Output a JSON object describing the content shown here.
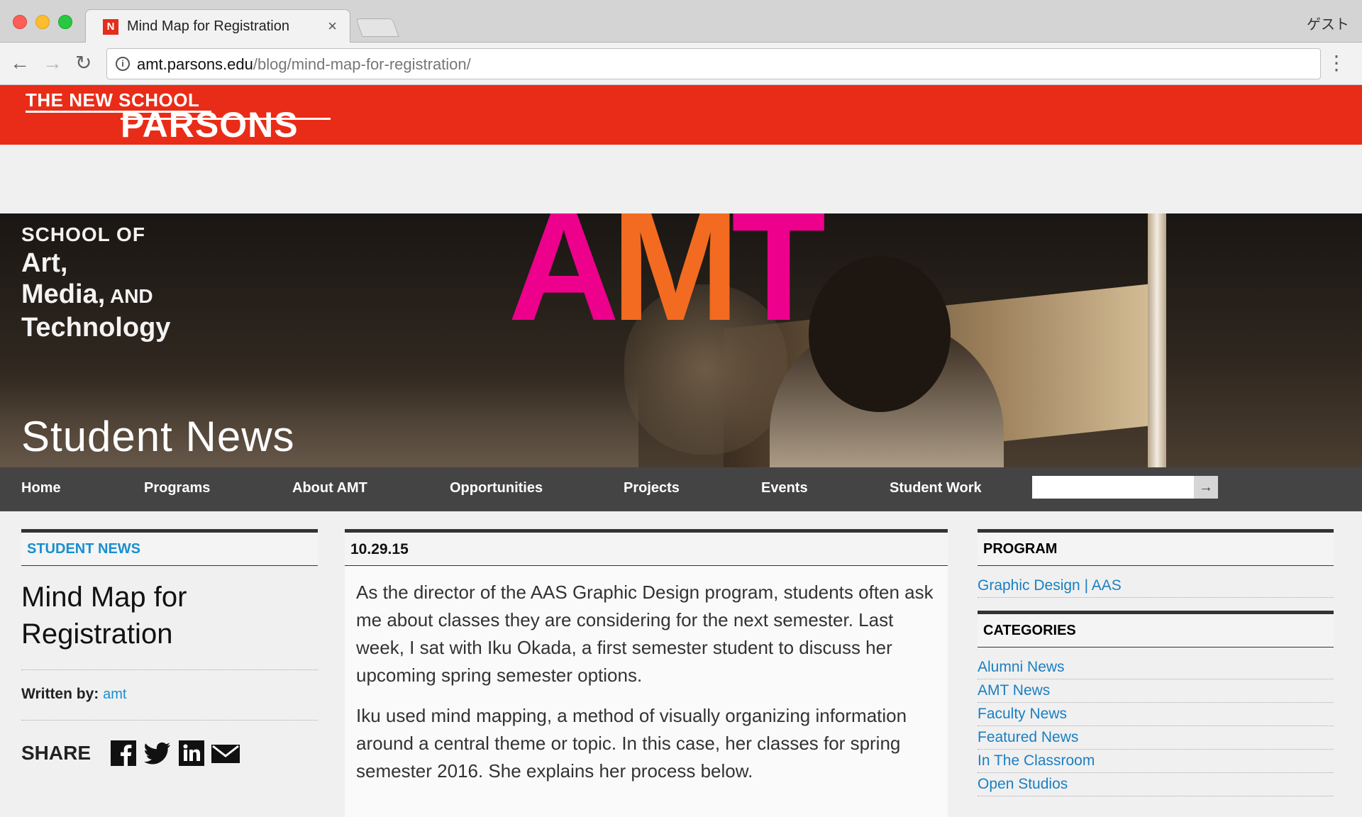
{
  "browser": {
    "tab_title": "Mind Map for Registration",
    "tab_close": "×",
    "profile": "ゲスト",
    "url_domain": "amt.parsons.edu",
    "url_path": "/blog/mind-map-for-registration/",
    "favicon_letter": "N"
  },
  "site": {
    "logo_top": "THE NEW SCHOOL",
    "logo_main": "PARSONS",
    "accent": "#e92c17",
    "link_color": "#1a8ecf"
  },
  "hero": {
    "school_of": "SCHOOL OF",
    "line1": "Art,",
    "line2": "Media,",
    "line2_small": " AND",
    "line3": "Technology",
    "amt_a": "A",
    "amt_m": "M",
    "amt_t": "T",
    "title": "Student News"
  },
  "nav": {
    "items": [
      "Home",
      "Programs",
      "About AMT",
      "Opportunities",
      "Projects",
      "Events",
      "Student Work"
    ],
    "search_go": "→"
  },
  "left": {
    "section": "STUDENT NEWS",
    "title": "Mind Map for Registration",
    "written_by_label": "Written by:",
    "author": "amt",
    "share_label": "SHARE",
    "social_icons": [
      "facebook-icon",
      "twitter-icon",
      "linkedin-icon",
      "email-icon"
    ]
  },
  "article": {
    "date": "10.29.15",
    "paragraphs": [
      "As the director of the AAS Graphic Design program, students often ask me about classes they are considering for the next semester. Last week, I sat with Iku Okada, a first semester student to discuss her upcoming spring semester options.",
      "Iku used mind mapping, a method of visually organizing information around a central theme or topic. In this case,  her classes for spring semester 2016. She explains her process below."
    ]
  },
  "right": {
    "program_head": "PROGRAM",
    "program_link": "Graphic Design | AAS",
    "categories_head": "CATEGORIES",
    "categories": [
      "Alumni News",
      "AMT News",
      "Faculty News",
      "Featured News",
      "In The Classroom",
      "Open Studios"
    ]
  }
}
